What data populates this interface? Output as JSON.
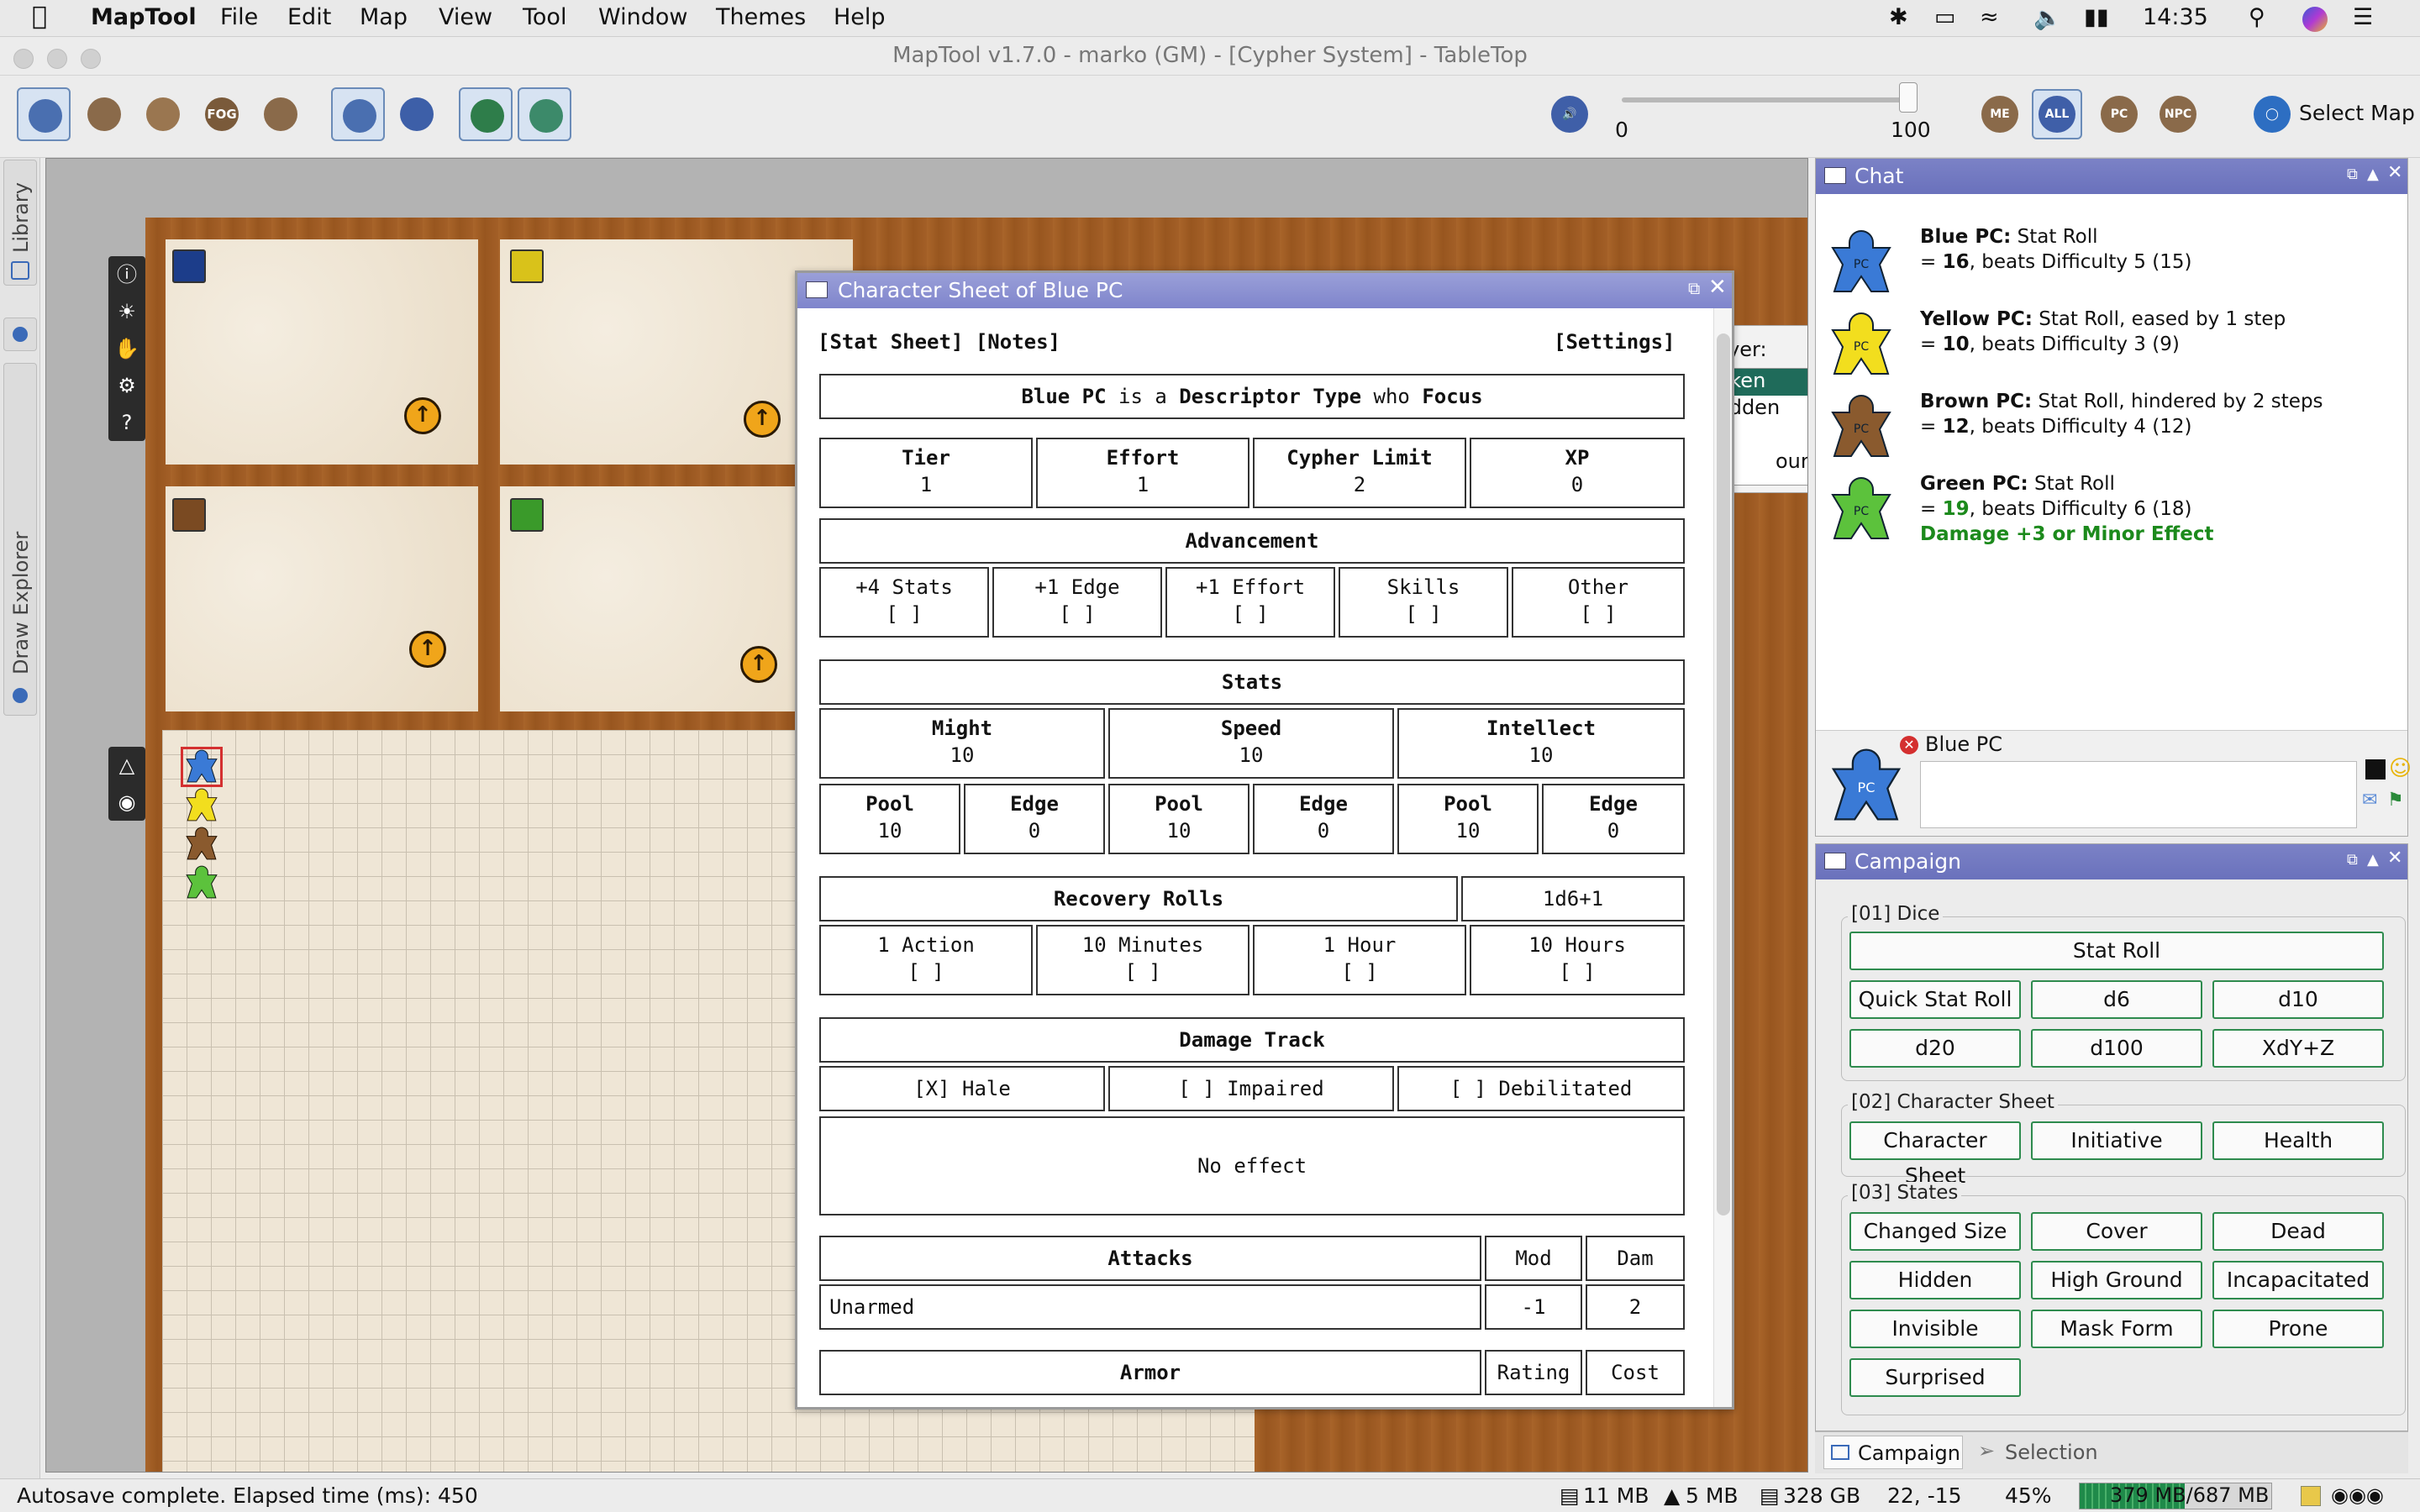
{
  "menubar": {
    "app_name": "MapTool",
    "items": [
      "File",
      "Edit",
      "Map",
      "View",
      "Tool",
      "Window",
      "Themes",
      "Help"
    ],
    "clock": "14:35"
  },
  "window": {
    "title": "MapTool v1.7.0 - marko (GM) - [Cypher System] - TableTop"
  },
  "toolbar": {
    "fog_label": "FOG",
    "slider": {
      "min_label": "0",
      "max_label": "100",
      "value": 100
    },
    "vis_buttons": [
      "ME",
      "ALL",
      "PC",
      "NPC"
    ],
    "select_map": "Select Map"
  },
  "left_tabs": {
    "library": "Library",
    "draw_explorer": "Draw Explorer"
  },
  "layer": {
    "label": "Layer:",
    "options": [
      "Token",
      "Hidden",
      "ound"
    ],
    "selected": "Token"
  },
  "sheet": {
    "title": "Character Sheet of Blue PC",
    "nav_left": "[Stat Sheet] [Notes]",
    "nav_right": "[Settings]",
    "intro": {
      "name": "Blue PC",
      "is_a": "is a",
      "descriptor": "Descriptor",
      "type": "Type",
      "who": "who",
      "focus": "Focus"
    },
    "core": [
      {
        "label": "Tier",
        "value": "1"
      },
      {
        "label": "Effort",
        "value": "1"
      },
      {
        "label": "Cypher Limit",
        "value": "2"
      },
      {
        "label": "XP",
        "value": "0"
      }
    ],
    "advancement_title": "Advancement",
    "advancement": [
      {
        "label": "+4 Stats",
        "value": "[ ]"
      },
      {
        "label": "+1 Edge",
        "value": "[ ]"
      },
      {
        "label": "+1 Effort",
        "value": "[ ]"
      },
      {
        "label": "Skills",
        "value": "[ ]"
      },
      {
        "label": "Other",
        "value": "[ ]"
      }
    ],
    "stats_title": "Stats",
    "stats": [
      {
        "label": "Might",
        "value": "10",
        "pool_label": "Pool",
        "pool": "10",
        "edge_label": "Edge",
        "edge": "0"
      },
      {
        "label": "Speed",
        "value": "10",
        "pool_label": "Pool",
        "pool": "10",
        "edge_label": "Edge",
        "edge": "0"
      },
      {
        "label": "Intellect",
        "value": "10",
        "pool_label": "Pool",
        "pool": "10",
        "edge_label": "Edge",
        "edge": "0"
      }
    ],
    "recovery_title": "Recovery Rolls",
    "recovery_roll": "1d6+1",
    "recovery": [
      {
        "label": "1 Action",
        "value": "[ ]"
      },
      {
        "label": "10 Minutes",
        "value": "[ ]"
      },
      {
        "label": "1 Hour",
        "value": "[ ]"
      },
      {
        "label": "10 Hours",
        "value": "[ ]"
      }
    ],
    "damage_title": "Damage Track",
    "damage": [
      "[X] Hale",
      "[ ] Impaired",
      "[ ] Debilitated"
    ],
    "damage_effect": "No effect",
    "attacks": {
      "title": "Attacks",
      "mod_label": "Mod",
      "dam_label": "Dam",
      "rows": [
        {
          "name": "Unarmed",
          "mod": "-1",
          "dam": "2"
        }
      ]
    },
    "armor": {
      "title": "Armor",
      "rating_label": "Rating",
      "cost_label": "Cost"
    }
  },
  "chat": {
    "title": "Chat",
    "messages": [
      {
        "who": "Blue PC:",
        "line1": " Stat Roll",
        "line2_pre": "= ",
        "roll": "16",
        "line2_post": ", beats Difficulty 5 (15)",
        "color": "#3a7ad6"
      },
      {
        "who": "Yellow PC:",
        "line1": " Stat Roll, eased by 1 step",
        "line2_pre": "= ",
        "roll": "10",
        "line2_post": ", beats Difficulty 3 (9)",
        "color": "#f2de1e"
      },
      {
        "who": "Brown PC:",
        "line1": " Stat Roll, hindered by 2 steps",
        "line2_pre": "= ",
        "roll": "12",
        "line2_post": ", beats Difficulty 4 (12)",
        "color": "#8a5a2e"
      },
      {
        "who": "Green PC:",
        "line1": " Stat Roll",
        "line2_pre": "= ",
        "roll": "19",
        "line2_post": ", beats Difficulty 6 (18)",
        "extra": "Damage +3 or Minor Effect",
        "color": "#5cc23c"
      }
    ],
    "speaker": "Blue PC",
    "meeple_label": "PC"
  },
  "campaign": {
    "title": "Campaign",
    "groups": [
      {
        "label": "[01] Dice",
        "buttons": [
          "Stat Roll",
          "Quick Stat Roll",
          "d6",
          "d10",
          "d20",
          "d100",
          "XdY+Z"
        ]
      },
      {
        "label": "[02] Character Sheet",
        "buttons": [
          "Character Sheet",
          "Initiative",
          "Health"
        ]
      },
      {
        "label": "[03] States",
        "buttons": [
          "Changed Size",
          "Cover",
          "Dead",
          "Hidden",
          "High Ground",
          "Incapacitated",
          "Invisible",
          "Mask Form",
          "Prone",
          "Surprised"
        ]
      }
    ]
  },
  "bottom_tabs": [
    "Campaign",
    "Selection"
  ],
  "status": {
    "message": "Autosave complete.  Elapsed time (ms): 450",
    "mem1": "11 MB",
    "mem2": "5 MB",
    "disk": "328 GB",
    "coords": "22, -15",
    "zoom": "45%",
    "heap": "379 MB/687 MB",
    "heap_fraction": 0.55
  }
}
